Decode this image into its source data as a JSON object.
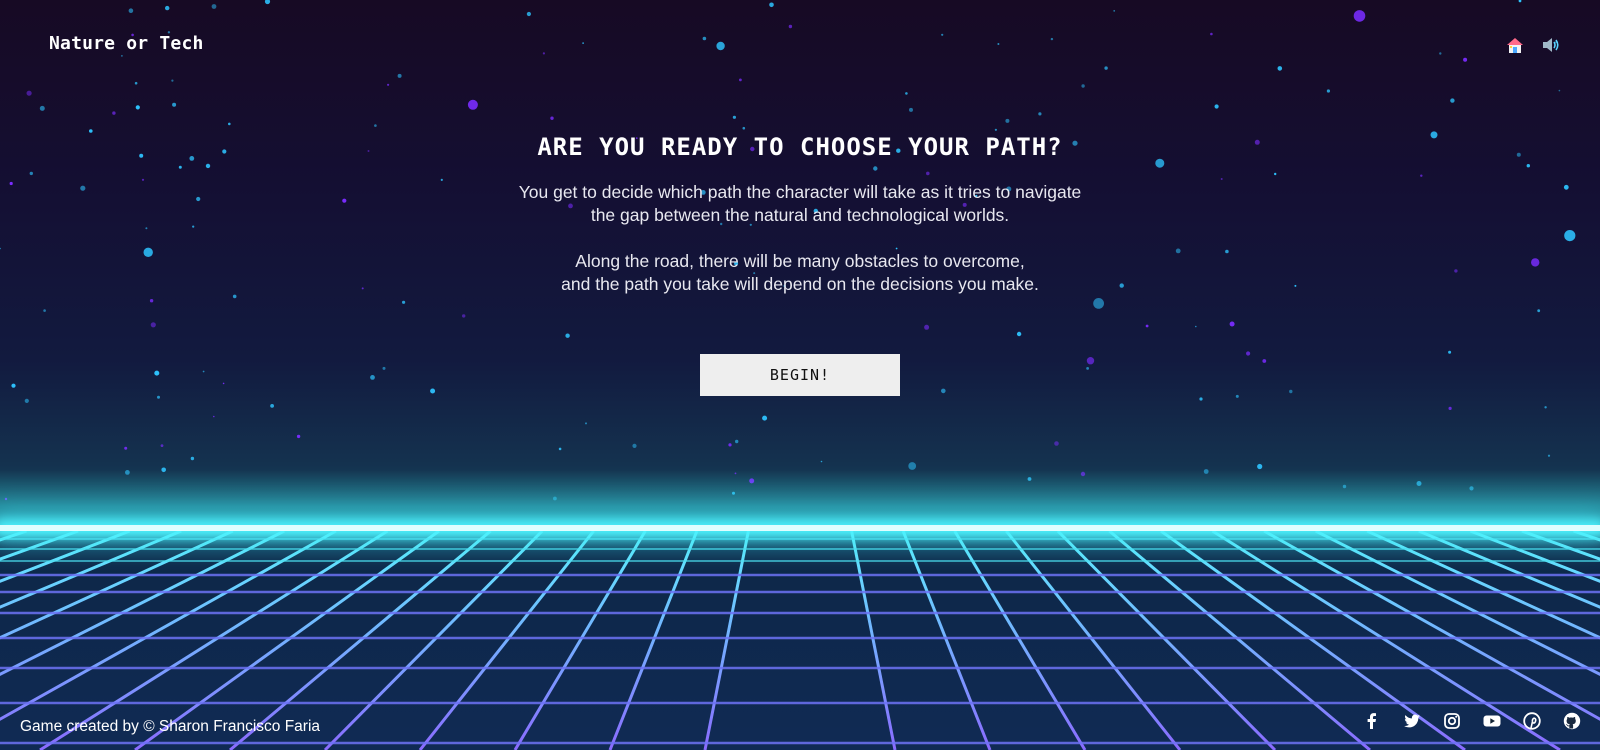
{
  "header": {
    "title": "Nature or Tech"
  },
  "hero": {
    "heading": "ARE YOU READY TO CHOOSE YOUR PATH?",
    "paragraph1_line1": "You get to decide which path the character will take as it tries to navigate",
    "paragraph1_line2": "the gap between the natural and technological worlds.",
    "paragraph2_line1": "Along the road, there will be many obstacles to overcome,",
    "paragraph2_line2": "and the path you take will depend on the decisions you make.",
    "begin_label": "BEGIN!"
  },
  "top_icons": [
    "home-icon",
    "sound-icon"
  ],
  "footer": {
    "credit": "Game created by © Sharon Francisco Faria",
    "social_icons": [
      "facebook-icon",
      "twitter-icon",
      "instagram-icon",
      "youtube-icon",
      "pinterest-icon",
      "github-icon"
    ]
  },
  "colors": {
    "accent_cyan": "#4ff4ff",
    "grid_purple": "#7b6cff",
    "button_bg": "#eeeeee"
  }
}
